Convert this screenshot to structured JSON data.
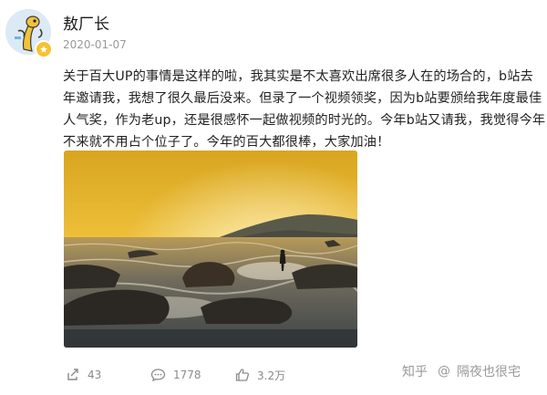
{
  "post": {
    "author": "敖厂长",
    "date": "2020-01-07",
    "text": "关于百大UP的事情是这样的啦，我其实是不太喜欢出席很多人在的场合的，b站去年邀请我，我想了很久最后没来。但录了一个视频领奖，因为b站要颁给我年度最佳人气奖，作为老up，还是很感怀一起做视频的时光的。今年b站又请我，我觉得今年不来就不用占个位子了。今年的百大都很棒，大家加油！",
    "image_icon": "photo-sunset-sea"
  },
  "actions": {
    "repost": {
      "icon": "repost-icon",
      "count": "43"
    },
    "comment": {
      "icon": "comment-icon",
      "count": "1778"
    },
    "like": {
      "icon": "thumbs-up-icon",
      "count": "3.2万"
    }
  },
  "watermark": {
    "site": "知乎",
    "mark": "@",
    "user": "隔夜也很宅"
  }
}
